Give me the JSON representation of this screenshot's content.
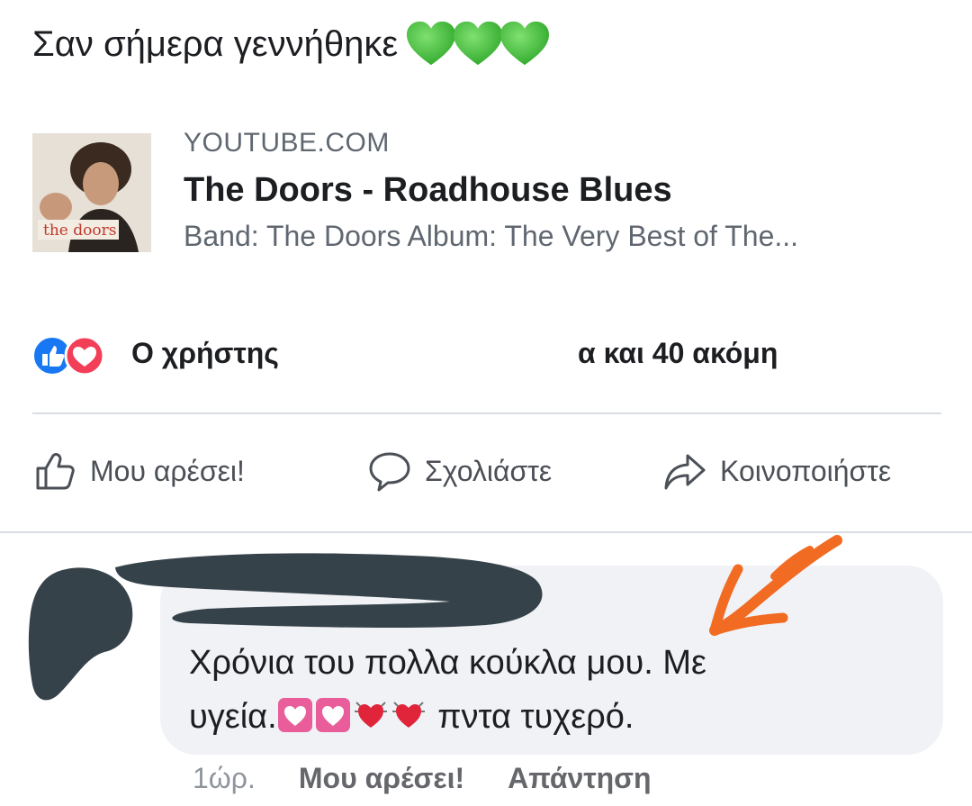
{
  "post": {
    "text": "Σαν σήμερα γεννήθηκε",
    "emoji": [
      "green-heart",
      "green-heart",
      "green-heart"
    ]
  },
  "link": {
    "domain": "YOUTUBE.COM",
    "title": "The Doors - Roadhouse Blues",
    "description": "Band: The Doors Album: The Very Best of The...",
    "thumbnail_text": "the doors"
  },
  "reactions": {
    "icons": [
      "like-reaction",
      "love-reaction"
    ],
    "names_prefix": "Ο χρήστης",
    "names_suffix": "α και 40 ακόμη"
  },
  "actions": {
    "like": "Μου αρέσει!",
    "comment": "Σχολιάστε",
    "share": "Κοινοποιήστε"
  },
  "comment": {
    "line1": "Χρόνια του πολλα κούκλα μου. Με",
    "line2_start": "υγεία.",
    "line2_end": "πντα τυχερό.",
    "emoji": [
      "heart-decoration",
      "heart-decoration",
      "beating-heart",
      "beating-heart"
    ],
    "time": "1ώρ.",
    "like_label": "Μου αρέσει!",
    "reply_label": "Απάντηση"
  },
  "colors": {
    "like_blue": "#1877f2",
    "love_red": "#f33e58",
    "heart_green": "#3fc93a",
    "bubble_bg": "#f0f2f5",
    "redaction": "#36424a",
    "arrow_orange": "#f26b22"
  }
}
